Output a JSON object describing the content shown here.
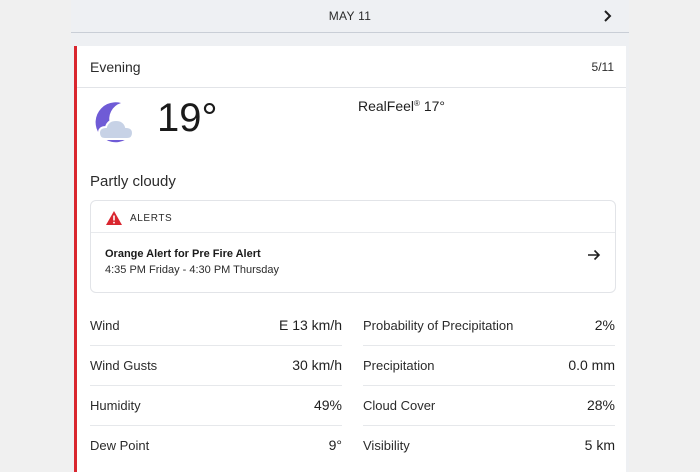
{
  "header": {
    "date": "MAY 11"
  },
  "card": {
    "period": "Evening",
    "date_num": "5/11",
    "temperature": "19°",
    "realfeel_label": "RealFeel",
    "realfeel_mark": "®",
    "realfeel_value": " 17°",
    "phrase": "Partly cloudy",
    "icon": "moon-cloud-icon"
  },
  "alerts": {
    "label": "ALERTS",
    "title": "Orange Alert for Pre Fire Alert",
    "time": "4:35 PM Friday - 4:30 PM Thursday"
  },
  "details": {
    "left": [
      {
        "label": "Wind",
        "value": "E 13 km/h"
      },
      {
        "label": "Wind Gusts",
        "value": "30 km/h"
      },
      {
        "label": "Humidity",
        "value": "49%"
      },
      {
        "label": "Dew Point",
        "value": "9°"
      }
    ],
    "right": [
      {
        "label": "Probability of Precipitation",
        "value": "2%"
      },
      {
        "label": "Precipitation",
        "value": "0.0 mm"
      },
      {
        "label": "Cloud Cover",
        "value": "28%"
      },
      {
        "label": "Visibility",
        "value": "5 km"
      }
    ]
  },
  "colors": {
    "accent": "#d9262f",
    "moon": "#6f5bd6",
    "cloud": "#c7d2e6"
  }
}
